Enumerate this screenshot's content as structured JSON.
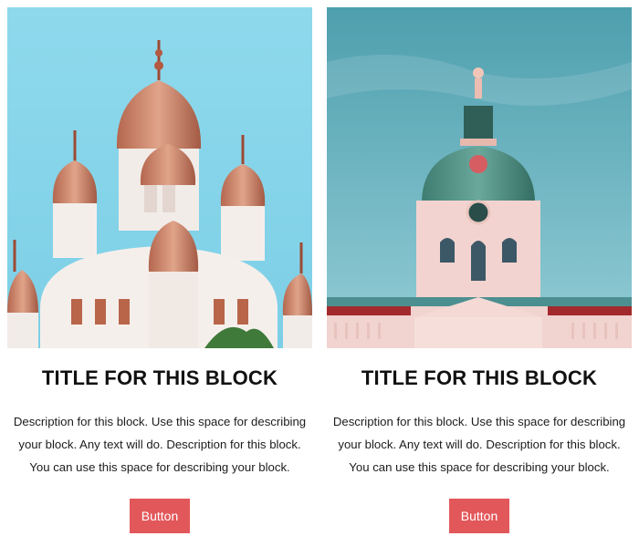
{
  "cards": [
    {
      "image": "temple-domes-photo",
      "title": "TITLE FOR THIS BLOCK",
      "description": "Description for this block. Use this space for describing your block. Any text will do. Description for this block. You can use this space for describing your block.",
      "button_label": "Button"
    },
    {
      "image": "palace-tower-photo",
      "title": "TITLE FOR THIS BLOCK",
      "description": "Description for this block. Use this space for describing your block. Any text will do. Description for this block. You can use this space for describing your block.",
      "button_label": "Button"
    }
  ],
  "colors": {
    "button_bg": "#e2575a",
    "button_text": "#ffffff",
    "title_text": "#111111"
  }
}
